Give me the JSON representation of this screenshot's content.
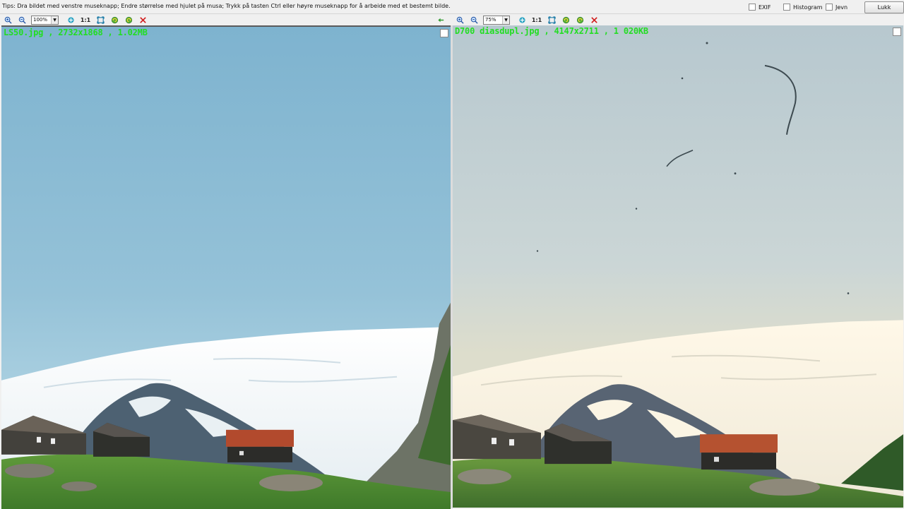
{
  "tips": "Tips: Dra bildet med venstre museknapp; Endre størrelse med hjulet på musa;  Trykk på tasten Ctrl eller høyre museknapp for å arbeide med et bestemt bilde.",
  "options": {
    "exif_label": "EXIF",
    "histogram_label": "Histogram",
    "jevn_label": "Jevn"
  },
  "close_label": "Lukk",
  "left": {
    "zoom": "100%",
    "one_to_one": "1:1",
    "caption": "LS50.jpg , 2732x1868 , 1.02MB"
  },
  "right": {
    "zoom": "75%",
    "one_to_one": "1:1",
    "caption": "D700 diasdupl.jpg , 4147x2711 , 1 020KB"
  },
  "colors": {
    "caption_text": "#22dd22",
    "left_sky": "#86b8d2",
    "right_sky": "#c5d2d6",
    "close_x": "#d11b1b"
  },
  "icons": [
    "zoom-in-icon",
    "zoom-out-icon",
    "fit-icon",
    "full-screen-icon",
    "rotate-left-icon",
    "rotate-right-icon",
    "close-image-icon",
    "back-arrow-icon"
  ]
}
